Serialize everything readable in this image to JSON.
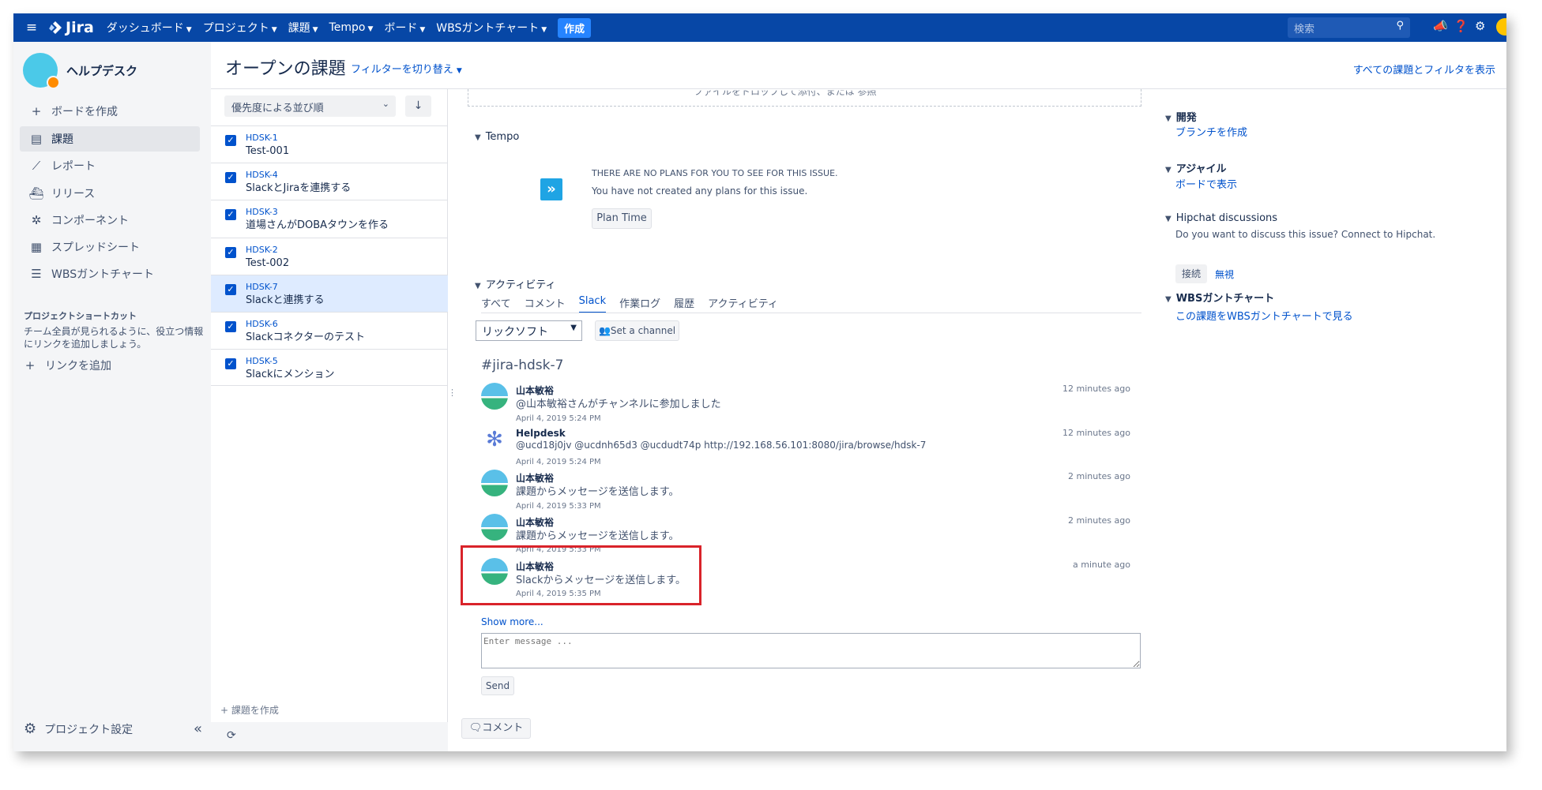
{
  "topnav": {
    "logo_text": "Jira",
    "menus": [
      "ダッシュボード",
      "プロジェクト",
      "課題",
      "Tempo",
      "ボード",
      "WBSガントチャート"
    ],
    "create_label": "作成",
    "search_placeholder": "検索"
  },
  "sidebar": {
    "project_name": "ヘルプデスク",
    "create_board": "ボードを作成",
    "items": [
      {
        "label": "課題",
        "icon": "issues-icon",
        "active": true
      },
      {
        "label": "レポート",
        "icon": "reports-icon"
      },
      {
        "label": "リリース",
        "icon": "releases-icon"
      },
      {
        "label": "コンポーネント",
        "icon": "components-icon"
      },
      {
        "label": "スプレッドシート",
        "icon": "spreadsheet-icon"
      },
      {
        "label": "WBSガントチャート",
        "icon": "gantt-icon"
      }
    ],
    "shortcut_heading": "プロジェクトショートカット",
    "shortcut_note": "チーム全員が見られるように、役立つ情報にリンクを追加しましょう。",
    "add_link": "リンクを追加",
    "settings": "プロジェクト設定"
  },
  "header": {
    "title": "オープンの課題",
    "filter_switch": "フィルターを切り替え",
    "all_filters": "すべての課題とフィルタを表示"
  },
  "issue_list": {
    "sort_label": "優先度による並び順",
    "issues": [
      {
        "key": "HDSK-1",
        "summary": "Test-001",
        "selected": false
      },
      {
        "key": "HDSK-4",
        "summary": "SlackとJiraを連携する",
        "selected": false
      },
      {
        "key": "HDSK-3",
        "summary": "道場さんがDOBAタウンを作る",
        "selected": false
      },
      {
        "key": "HDSK-2",
        "summary": "Test-002",
        "selected": false
      },
      {
        "key": "HDSK-7",
        "summary": "Slackと連携する",
        "selected": true
      },
      {
        "key": "HDSK-6",
        "summary": "Slackコネクターのテスト",
        "selected": false
      },
      {
        "key": "HDSK-5",
        "summary": "Slackにメンション",
        "selected": false
      }
    ],
    "create_issue": "+ 課題を作成"
  },
  "detail": {
    "dropzone_text": "ファイルをドロップして添付、または 参照",
    "tempo": {
      "title": "Tempo",
      "heading": "THERE ARE NO PLANS FOR YOU TO SEE FOR THIS ISSUE.",
      "text": "You have not created any plans for this issue.",
      "button": "Plan Time"
    },
    "activity": {
      "title": "アクティビティ",
      "tabs": [
        "すべて",
        "コメント",
        "Slack",
        "作業ログ",
        "履歴",
        "アクティビティ"
      ],
      "active_tab": "Slack",
      "workspace": "リックソフト",
      "set_channel": "Set a channel",
      "channel": "#jira-hdsk-7",
      "messages": [
        {
          "name": "山本敏裕",
          "text": "@山本敏裕さんがチャンネルに参加しました",
          "ago": "12 minutes ago",
          "date": "April 4, 2019 5:24 PM",
          "avatar": "user-avatar"
        },
        {
          "name": "Helpdesk",
          "text": "@ucd18j0jv @ucdnh65d3 @ucdudt74p http://192.168.56.101:8080/jira/browse/hdsk-7",
          "ago": "12 minutes ago",
          "date": "April 4, 2019 5:24 PM",
          "avatar": "slack-bot-icon"
        },
        {
          "name": "山本敏裕",
          "text": "課題からメッセージを送信します。",
          "ago": "2 minutes ago",
          "date": "April 4, 2019 5:33 PM",
          "avatar": "user-avatar"
        },
        {
          "name": "山本敏裕",
          "text": "課題からメッセージを送信します。",
          "ago": "2 minutes ago",
          "date": "April 4, 2019 5:33 PM",
          "avatar": "user-avatar"
        },
        {
          "name": "山本敏裕",
          "text": "Slackからメッセージを送信します。",
          "ago": "a minute ago",
          "date": "April 4, 2019 5:35 PM",
          "avatar": "user-avatar"
        }
      ],
      "show_more": "Show more...",
      "input_placeholder": "Enter message ...",
      "send": "Send"
    },
    "comment_button": "コメント"
  },
  "right_column": {
    "dev_title": "開発",
    "dev_link": "ブランチを作成",
    "agile_title": "アジャイル",
    "agile_link": "ボードで表示",
    "hipchat_title": "Hipchat discussions",
    "hipchat_text": "Do you want to discuss this issue? Connect to Hipchat.",
    "hipchat_connect": "接続",
    "hipchat_ignore": "無視",
    "wbs_title": "WBSガントチャート",
    "wbs_link": "この課題をWBSガントチャートで見る"
  },
  "colors": {
    "nav": "#0747a6",
    "link": "#0052cc",
    "highlight": "#d9232a"
  }
}
